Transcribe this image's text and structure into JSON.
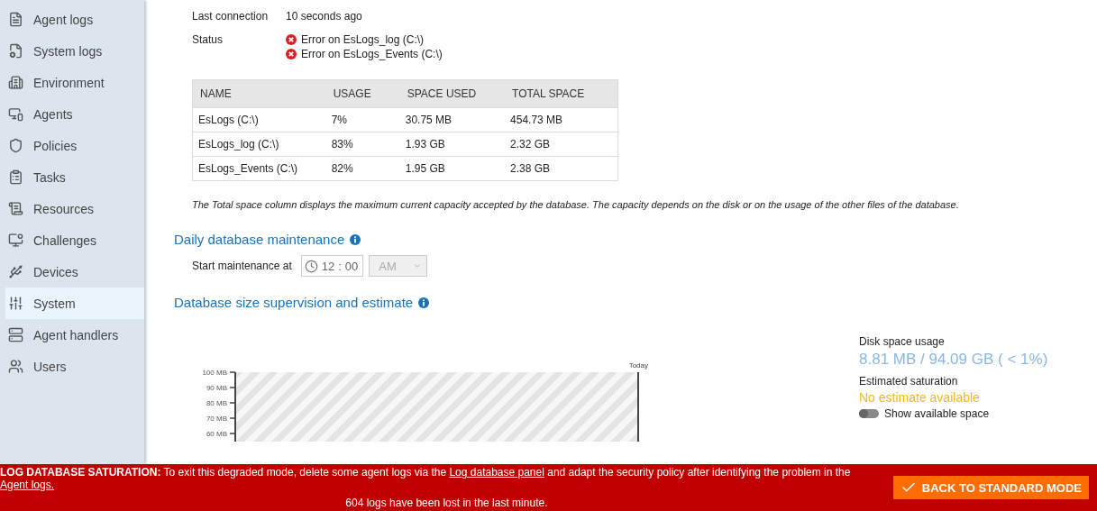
{
  "sidebar": {
    "items": [
      {
        "label": "Agent logs",
        "selected": false
      },
      {
        "label": "System logs",
        "selected": false
      },
      {
        "label": "Environment",
        "selected": false
      },
      {
        "label": "Agents",
        "selected": false
      },
      {
        "label": "Policies",
        "selected": false
      },
      {
        "label": "Tasks",
        "selected": false
      },
      {
        "label": "Resources",
        "selected": false
      },
      {
        "label": "Challenges",
        "selected": false
      },
      {
        "label": "Devices",
        "selected": false
      },
      {
        "label": "System",
        "selected": true
      },
      {
        "label": "Agent handlers",
        "selected": false
      },
      {
        "label": "Users",
        "selected": false
      }
    ]
  },
  "connection": {
    "label": "Last connection",
    "value": "10 seconds ago"
  },
  "status": {
    "label": "Status",
    "errors": [
      "Error on EsLogs_log (C:\\)",
      "Error on EsLogs_Events (C:\\)"
    ]
  },
  "table": {
    "columns": [
      "NAME",
      "USAGE",
      "SPACE USED",
      "TOTAL SPACE"
    ],
    "rows": [
      [
        "EsLogs (C:\\)",
        "7%",
        "30.75 MB",
        "454.73 MB"
      ],
      [
        "EsLogs_log (C:\\)",
        "83%",
        "1.93 GB",
        "2.32 GB"
      ],
      [
        "EsLogs_Events (C:\\)",
        "82%",
        "1.95 GB",
        "2.38 GB"
      ]
    ]
  },
  "table_note": "The Total space column displays the maximum current capacity accepted by the database. The capacity depends on the disk or on the usage of the other files of the database.",
  "maintenance": {
    "title": "Daily database maintenance",
    "label": "Start maintenance at",
    "hours": "12",
    "separator": ":",
    "minutes": "00",
    "period": "AM",
    "period_disabled": true
  },
  "supervision": {
    "title": "Database size supervision and estimate",
    "chart": {
      "y_labels": [
        "100 MB",
        "90 MB",
        "80 MB",
        "70 MB",
        "60 MB"
      ],
      "marker_label": "Today"
    },
    "disk_label": "Disk space usage",
    "disk_value": "8.81 MB / 94.09 GB  ( < 1%)",
    "saturation_label": "Estimated saturation",
    "saturation_value": "No estimate available",
    "toggle": {
      "label": "Show available space",
      "on": false
    }
  },
  "banner": {
    "lead": "**LOG DATABASE SATURATION:** To exit this degraded mode, delete some agent logs via the",
    "link_1": "Log database panel",
    "middle": "and adapt the security policy after identifying the problem in the",
    "link_2": "Agent logs.",
    "second_line": "604 logs have been lost in the last minute.",
    "button": "BACK TO STANDARD MODE"
  }
}
